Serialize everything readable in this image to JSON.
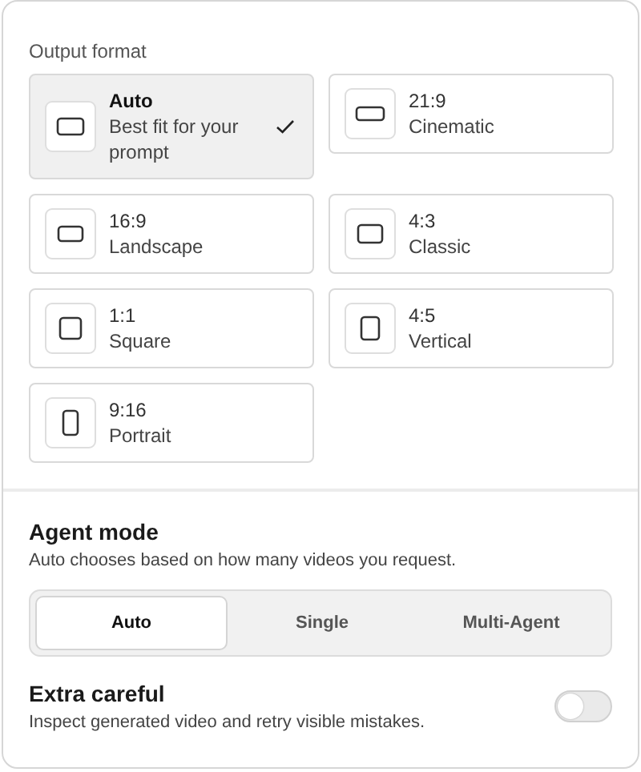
{
  "output_format": {
    "title": "Output format",
    "options": [
      {
        "kind": "auto",
        "label": "Auto",
        "description": "Best fit for your prompt",
        "selected": true
      },
      {
        "kind": "ultrawide",
        "label": "21:9",
        "description": "Cinematic",
        "selected": false
      },
      {
        "kind": "landscape",
        "label": "16:9",
        "description": "Landscape",
        "selected": false
      },
      {
        "kind": "classic",
        "label": "4:3",
        "description": "Classic",
        "selected": false
      },
      {
        "kind": "square",
        "label": "1:1",
        "description": "Square",
        "selected": false
      },
      {
        "kind": "vertical",
        "label": "4:5",
        "description": "Vertical",
        "selected": false
      },
      {
        "kind": "portrait",
        "label": "9:16",
        "description": "Portrait",
        "selected": false
      }
    ]
  },
  "agent_mode": {
    "title": "Agent mode",
    "description": "Auto chooses based on how many videos you request.",
    "options": [
      {
        "label": "Auto",
        "selected": true
      },
      {
        "label": "Single",
        "selected": false
      },
      {
        "label": "Multi-Agent",
        "selected": false
      }
    ]
  },
  "extra_careful": {
    "title": "Extra careful",
    "description": "Inspect generated video and retry visible mistakes.",
    "on": false
  }
}
